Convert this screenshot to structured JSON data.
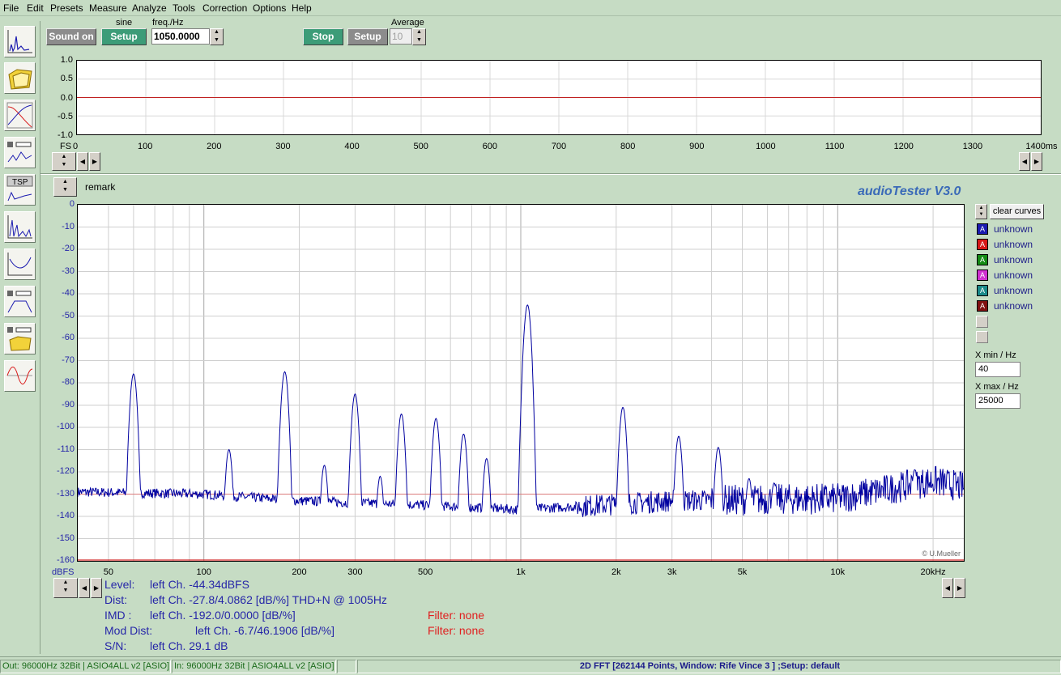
{
  "menu": [
    "File",
    "Edit",
    "Presets",
    "Measure",
    "Analyze",
    "Tools",
    "Correction",
    "Options",
    "Help"
  ],
  "generator": {
    "sound_button": "Sound on",
    "mode_label": "sine",
    "setup_button": "Setup",
    "freq_label": "freq./Hz",
    "freq_value": "1050.0000"
  },
  "analyzer": {
    "stop_button": "Stop",
    "setup_button": "Setup",
    "average_label": "Average",
    "average_value": "10"
  },
  "scope": {
    "y_ticks": [
      "1.0",
      "0.5",
      "0.0",
      "-0.5",
      "-1.0"
    ],
    "x_prefix": "FS",
    "x_ticks": [
      "0",
      "100",
      "200",
      "300",
      "400",
      "500",
      "600",
      "700",
      "800",
      "900",
      "1000",
      "1100",
      "1200",
      "1300",
      "1400ms"
    ]
  },
  "fft": {
    "remark": "remark",
    "brand": "audioTester  V3.0",
    "y_unit": "dBFS",
    "y_ticks": [
      "0",
      "-10",
      "-20",
      "-30",
      "-40",
      "-50",
      "-60",
      "-70",
      "-80",
      "-90",
      "-100",
      "-110",
      "-120",
      "-130",
      "-140",
      "-150",
      "-160"
    ],
    "x_ticks": [
      "50",
      "100",
      "200",
      "300",
      "500",
      "1k",
      "2k",
      "3k",
      "5k",
      "10k",
      "20kHz"
    ],
    "copyright": "© U.Mueller",
    "clear_button": "clear curves",
    "legend": [
      {
        "letter": "A",
        "color": "#1b1bb0",
        "label": "unknown"
      },
      {
        "letter": "A",
        "color": "#d81818",
        "label": "unknown"
      },
      {
        "letter": "A",
        "color": "#148a14",
        "label": "unknown"
      },
      {
        "letter": "A",
        "color": "#d030d0",
        "label": "unknown"
      },
      {
        "letter": "A",
        "color": "#1a8a8a",
        "label": "unknown"
      },
      {
        "letter": "A",
        "color": "#801010",
        "label": "unknown"
      }
    ],
    "xmin_label": "X min / Hz",
    "xmin_value": "40",
    "xmax_label": "X max / Hz",
    "xmax_value": "25000"
  },
  "results": {
    "level_label": "Level:",
    "level_value": "left Ch. -44.34dBFS",
    "dist_label": "Dist:",
    "dist_value": "left Ch. -27.8/4.0862 [dB/%] THD+N  @ 1005Hz",
    "imd_label": "IMD  :",
    "imd_value": "left Ch. -192.0/0.0000 [dB/%]",
    "imd_filter": "Filter: none",
    "mod_label": "Mod Dist:",
    "mod_value": "left Ch. -6.7/46.1906 [dB/%]",
    "mod_filter": "Filter: none",
    "sn_label": "S/N:",
    "sn_value": "left Ch. 29.1 dB"
  },
  "status": {
    "out": "Out: 96000Hz 32Bit  | ASIO4ALL v2 [ASIO]",
    "in": "In: 96000Hz 32Bit  | ASIO4ALL v2 [ASIO]",
    "info": "2D FFT [262144 Points, Window: Rife Vince 3 ] ;Setup:  default"
  },
  "chart_data": {
    "type": "line",
    "title": "",
    "xlabel": "",
    "ylabel": "dBFS",
    "x_scale": "log",
    "xlim": [
      40,
      25000
    ],
    "ylim": [
      -160,
      0
    ],
    "series": [
      {
        "color": "#0000a0",
        "noise_floor_db": [
          [
            40,
            -129
          ],
          [
            100,
            -130
          ],
          [
            200,
            -133
          ],
          [
            500,
            -135
          ],
          [
            1000,
            -137
          ],
          [
            3000,
            -133
          ],
          [
            10000,
            -132
          ],
          [
            20000,
            -124
          ],
          [
            25000,
            -127
          ]
        ],
        "peaks": [
          {
            "x": 60,
            "y": -76
          },
          {
            "x": 120,
            "y": -110
          },
          {
            "x": 180,
            "y": -75
          },
          {
            "x": 240,
            "y": -117
          },
          {
            "x": 300,
            "y": -85
          },
          {
            "x": 360,
            "y": -122
          },
          {
            "x": 420,
            "y": -94
          },
          {
            "x": 540,
            "y": -96
          },
          {
            "x": 660,
            "y": -103
          },
          {
            "x": 780,
            "y": -114
          },
          {
            "x": 1050,
            "y": -45
          },
          {
            "x": 2100,
            "y": -91
          },
          {
            "x": 3150,
            "y": -104
          },
          {
            "x": 4200,
            "y": -109
          },
          {
            "x": 5250,
            "y": -123
          },
          {
            "x": 6300,
            "y": -125
          },
          {
            "x": 17500,
            "y": -119
          }
        ]
      }
    ]
  }
}
